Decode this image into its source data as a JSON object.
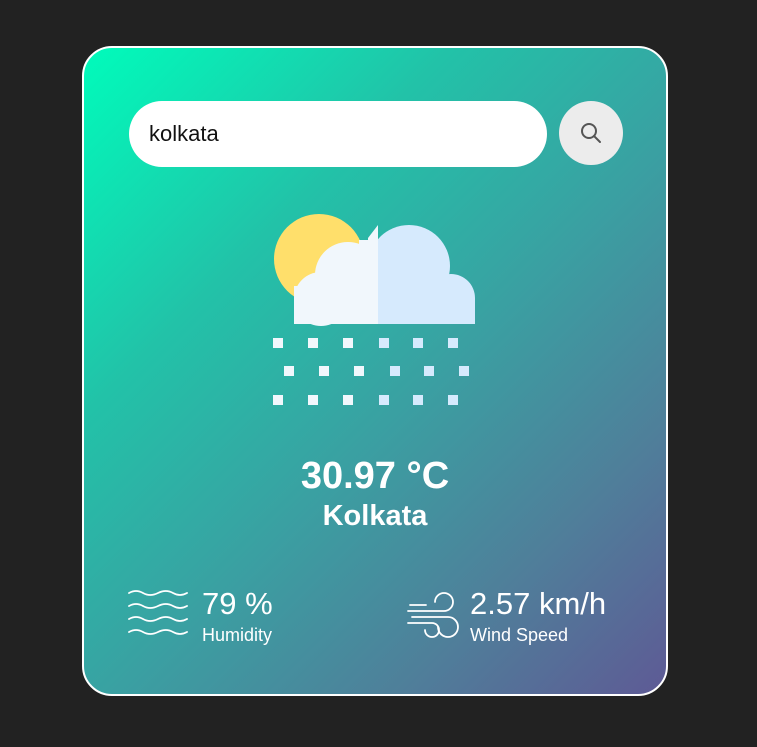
{
  "search": {
    "value": "kolkata",
    "button_icon": "search-icon"
  },
  "weather": {
    "icon": "snow-cloud-sun-icon",
    "temperature": "30.97 °C",
    "city": "Kolkata"
  },
  "details": {
    "humidity": {
      "icon": "humidity-waves-icon",
      "value": "79 %",
      "label": "Humidity"
    },
    "wind": {
      "icon": "wind-icon",
      "value": "2.57 km/h",
      "label": "Wind Speed"
    }
  },
  "colors": {
    "page_background": "#222222",
    "gradient_start": "#00fcbb",
    "gradient_end": "#5e5a95",
    "sun": "#ffdf6b",
    "cloud_light": "#f1f7fc",
    "cloud_shade": "#d6eafd"
  }
}
